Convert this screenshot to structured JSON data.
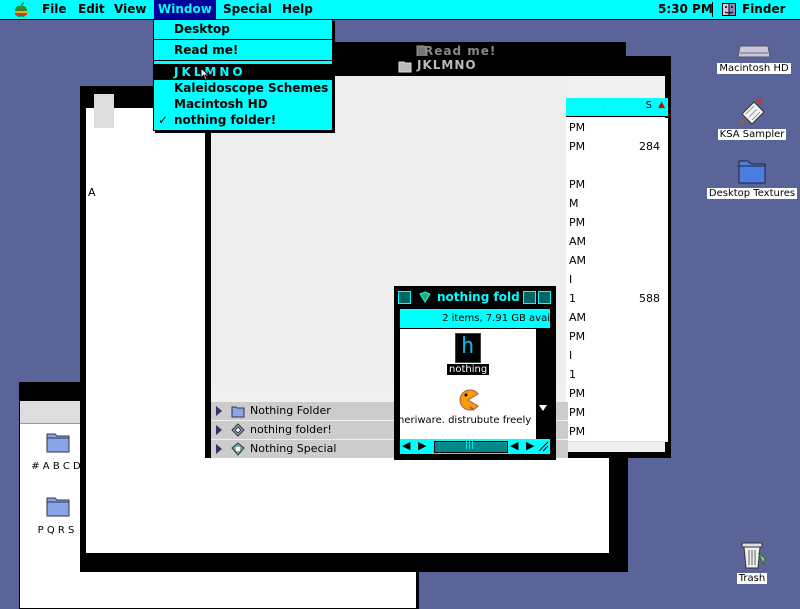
{
  "menubar": {
    "apple": "apple-menu",
    "items": [
      "File",
      "Edit",
      "View",
      "Window",
      "Special",
      "Help"
    ],
    "active": "Window",
    "clock": "5:30 PM",
    "app": "Finder"
  },
  "window_menu": {
    "items": [
      {
        "label": "Desktop",
        "checked": false,
        "highlighted": false
      },
      {
        "label": "Read me!",
        "checked": false,
        "highlighted": false
      },
      {
        "label": "JKLMNO",
        "checked": false,
        "highlighted": true
      },
      {
        "label": "Kaleidoscope Schemes",
        "checked": false,
        "highlighted": false
      },
      {
        "label": "Macintosh HD",
        "checked": false,
        "highlighted": false
      },
      {
        "label": "nothing folder!",
        "checked": true,
        "highlighted": false
      }
    ],
    "check_glyph": "✓"
  },
  "windows": {
    "readme": {
      "title": "Read me!"
    },
    "jklmno": {
      "title": "JKLMNO",
      "column_header": "S",
      "rows": [
        {
          "date": "PM",
          "size": ""
        },
        {
          "date": "PM",
          "size": "284"
        },
        {
          "date": "",
          "size": ""
        },
        {
          "date": "PM",
          "size": ""
        },
        {
          "date": "M",
          "size": ""
        },
        {
          "date": "PM",
          "size": ""
        },
        {
          "date": "AM",
          "size": ""
        },
        {
          "date": "AM",
          "size": ""
        },
        {
          "date": "I",
          "size": ""
        },
        {
          "date": "1",
          "size": "588"
        },
        {
          "date": "AM",
          "size": ""
        },
        {
          "date": "PM",
          "size": ""
        },
        {
          "date": "I",
          "size": ""
        },
        {
          "date": "1",
          "size": ""
        },
        {
          "date": "PM",
          "size": ""
        },
        {
          "date": "PM",
          "size": ""
        },
        {
          "date": "PM",
          "size": ""
        }
      ],
      "items": [
        {
          "label": "Nothing Folder",
          "icon": "folder-icon"
        },
        {
          "label": "nothing folder!",
          "icon": "kaleidoscope-icon"
        },
        {
          "label": "Nothing Special",
          "icon": "application-icon"
        }
      ]
    },
    "large": {
      "fragment": "A"
    },
    "bottom_left": {
      "folders": [
        "# A B C D",
        "P Q R S"
      ]
    },
    "nothing_folder": {
      "title": "nothing folde",
      "info": "2 items, 7.91 GB avai",
      "items": [
        {
          "label": "nothing",
          "icon": "nothing-app-icon",
          "selected": true
        },
        {
          "label": "heriware. distrubute freely",
          "icon": "pacman-icon",
          "selected": false
        }
      ]
    }
  },
  "desktop_icons": [
    {
      "label": "Macintosh HD",
      "icon": "hard-disk-icon"
    },
    {
      "label": "KSA Sampler",
      "icon": "sampler-document-icon"
    },
    {
      "label": "Desktop Textures",
      "icon": "folder-icon"
    },
    {
      "label": "Trash",
      "icon": "trash-icon"
    }
  ],
  "colors": {
    "desktop": "#5a6499",
    "accent": "#00ffff",
    "menu_highlight": "#000099"
  }
}
